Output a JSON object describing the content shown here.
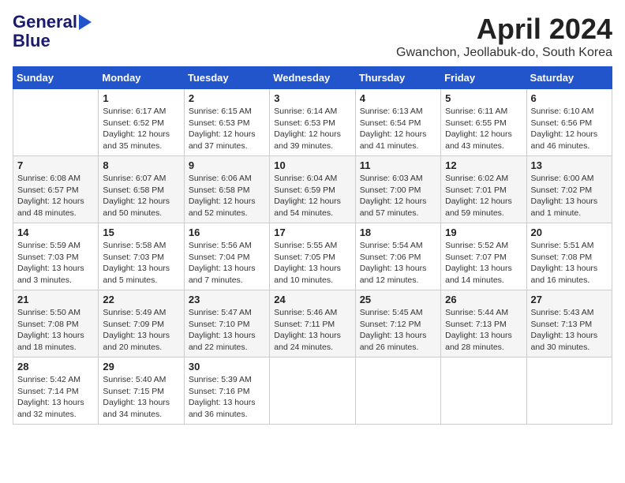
{
  "header": {
    "logo_line1": "General",
    "logo_line2": "Blue",
    "month_title": "April 2024",
    "location": "Gwanchon, Jeollabuk-do, South Korea"
  },
  "weekdays": [
    "Sunday",
    "Monday",
    "Tuesday",
    "Wednesday",
    "Thursday",
    "Friday",
    "Saturday"
  ],
  "weeks": [
    [
      {
        "day": "",
        "info": ""
      },
      {
        "day": "1",
        "info": "Sunrise: 6:17 AM\nSunset: 6:52 PM\nDaylight: 12 hours\nand 35 minutes."
      },
      {
        "day": "2",
        "info": "Sunrise: 6:15 AM\nSunset: 6:53 PM\nDaylight: 12 hours\nand 37 minutes."
      },
      {
        "day": "3",
        "info": "Sunrise: 6:14 AM\nSunset: 6:53 PM\nDaylight: 12 hours\nand 39 minutes."
      },
      {
        "day": "4",
        "info": "Sunrise: 6:13 AM\nSunset: 6:54 PM\nDaylight: 12 hours\nand 41 minutes."
      },
      {
        "day": "5",
        "info": "Sunrise: 6:11 AM\nSunset: 6:55 PM\nDaylight: 12 hours\nand 43 minutes."
      },
      {
        "day": "6",
        "info": "Sunrise: 6:10 AM\nSunset: 6:56 PM\nDaylight: 12 hours\nand 46 minutes."
      }
    ],
    [
      {
        "day": "7",
        "info": "Sunrise: 6:08 AM\nSunset: 6:57 PM\nDaylight: 12 hours\nand 48 minutes."
      },
      {
        "day": "8",
        "info": "Sunrise: 6:07 AM\nSunset: 6:58 PM\nDaylight: 12 hours\nand 50 minutes."
      },
      {
        "day": "9",
        "info": "Sunrise: 6:06 AM\nSunset: 6:58 PM\nDaylight: 12 hours\nand 52 minutes."
      },
      {
        "day": "10",
        "info": "Sunrise: 6:04 AM\nSunset: 6:59 PM\nDaylight: 12 hours\nand 54 minutes."
      },
      {
        "day": "11",
        "info": "Sunrise: 6:03 AM\nSunset: 7:00 PM\nDaylight: 12 hours\nand 57 minutes."
      },
      {
        "day": "12",
        "info": "Sunrise: 6:02 AM\nSunset: 7:01 PM\nDaylight: 12 hours\nand 59 minutes."
      },
      {
        "day": "13",
        "info": "Sunrise: 6:00 AM\nSunset: 7:02 PM\nDaylight: 13 hours\nand 1 minute."
      }
    ],
    [
      {
        "day": "14",
        "info": "Sunrise: 5:59 AM\nSunset: 7:03 PM\nDaylight: 13 hours\nand 3 minutes."
      },
      {
        "day": "15",
        "info": "Sunrise: 5:58 AM\nSunset: 7:03 PM\nDaylight: 13 hours\nand 5 minutes."
      },
      {
        "day": "16",
        "info": "Sunrise: 5:56 AM\nSunset: 7:04 PM\nDaylight: 13 hours\nand 7 minutes."
      },
      {
        "day": "17",
        "info": "Sunrise: 5:55 AM\nSunset: 7:05 PM\nDaylight: 13 hours\nand 10 minutes."
      },
      {
        "day": "18",
        "info": "Sunrise: 5:54 AM\nSunset: 7:06 PM\nDaylight: 13 hours\nand 12 minutes."
      },
      {
        "day": "19",
        "info": "Sunrise: 5:52 AM\nSunset: 7:07 PM\nDaylight: 13 hours\nand 14 minutes."
      },
      {
        "day": "20",
        "info": "Sunrise: 5:51 AM\nSunset: 7:08 PM\nDaylight: 13 hours\nand 16 minutes."
      }
    ],
    [
      {
        "day": "21",
        "info": "Sunrise: 5:50 AM\nSunset: 7:08 PM\nDaylight: 13 hours\nand 18 minutes."
      },
      {
        "day": "22",
        "info": "Sunrise: 5:49 AM\nSunset: 7:09 PM\nDaylight: 13 hours\nand 20 minutes."
      },
      {
        "day": "23",
        "info": "Sunrise: 5:47 AM\nSunset: 7:10 PM\nDaylight: 13 hours\nand 22 minutes."
      },
      {
        "day": "24",
        "info": "Sunrise: 5:46 AM\nSunset: 7:11 PM\nDaylight: 13 hours\nand 24 minutes."
      },
      {
        "day": "25",
        "info": "Sunrise: 5:45 AM\nSunset: 7:12 PM\nDaylight: 13 hours\nand 26 minutes."
      },
      {
        "day": "26",
        "info": "Sunrise: 5:44 AM\nSunset: 7:13 PM\nDaylight: 13 hours\nand 28 minutes."
      },
      {
        "day": "27",
        "info": "Sunrise: 5:43 AM\nSunset: 7:13 PM\nDaylight: 13 hours\nand 30 minutes."
      }
    ],
    [
      {
        "day": "28",
        "info": "Sunrise: 5:42 AM\nSunset: 7:14 PM\nDaylight: 13 hours\nand 32 minutes."
      },
      {
        "day": "29",
        "info": "Sunrise: 5:40 AM\nSunset: 7:15 PM\nDaylight: 13 hours\nand 34 minutes."
      },
      {
        "day": "30",
        "info": "Sunrise: 5:39 AM\nSunset: 7:16 PM\nDaylight: 13 hours\nand 36 minutes."
      },
      {
        "day": "",
        "info": ""
      },
      {
        "day": "",
        "info": ""
      },
      {
        "day": "",
        "info": ""
      },
      {
        "day": "",
        "info": ""
      }
    ]
  ]
}
